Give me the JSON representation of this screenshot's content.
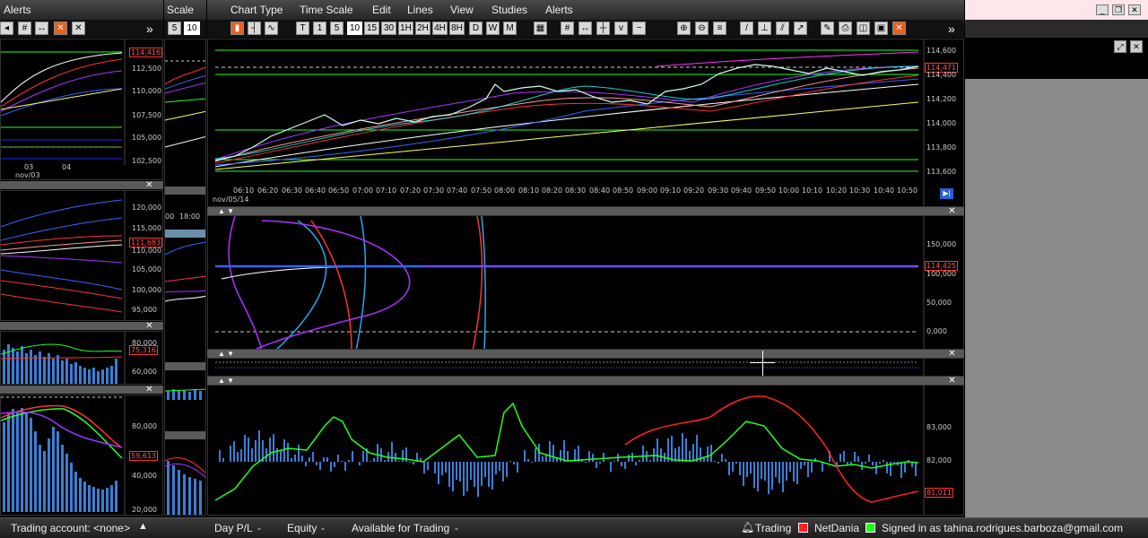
{
  "left_window": {
    "title": "Alerts"
  },
  "scale_window": {
    "title": "Scale",
    "btn_5": "5",
    "btn_10": "10",
    "time_00": "00",
    "time_1800": "18:00"
  },
  "menu": {
    "items": [
      "Chart Type",
      "Time Scale",
      "Edit",
      "Lines",
      "View",
      "Studies",
      "Alerts"
    ]
  },
  "toolbar": {
    "chevron": "»",
    "b1": "1",
    "b5": "5",
    "b10": "10",
    "b15": "15",
    "b30": "30",
    "b1h": "1H",
    "b2h": "2H",
    "b4h": "4H",
    "b8h": "8H",
    "bd": "D",
    "bw": "W",
    "bm": "M",
    "t_btn": "T"
  },
  "main_chart": {
    "price_labels": [
      "114,600",
      "114,400",
      "114,200",
      "114,000",
      "113,800",
      "113,600"
    ],
    "last_price": "114,471",
    "time_labels": [
      "06:10",
      "06:20",
      "06:30",
      "06:40",
      "06:50",
      "07:00",
      "07:10",
      "07:20",
      "07:30",
      "07:40",
      "07:50",
      "08:00",
      "08:10",
      "08:20",
      "08:30",
      "08:40",
      "08:50",
      "09:00",
      "09:10",
      "09:20",
      "09:30",
      "09:40",
      "09:50",
      "10:00",
      "10:10",
      "10:20",
      "10:30",
      "10:40",
      "10:50"
    ],
    "date_label": "nov/05/14"
  },
  "volume_panel": {
    "labels": [
      "150,000",
      "100,000",
      "50,000",
      "0,000"
    ],
    "badge": "114,425"
  },
  "oscillator_panel": {
    "labels": [
      "83,000",
      "82,000"
    ],
    "badge": "81,011"
  },
  "left_mini": {
    "p1_labels": [
      "114,000",
      "112,500",
      "110,000",
      "107,500",
      "105,000",
      "102,500"
    ],
    "p1_badge": "114,416",
    "p1_times": [
      "03",
      "04"
    ],
    "p1_date": "nov/03",
    "p2_labels": [
      "120,000",
      "115,000",
      "110,000",
      "105,000",
      "100,000",
      "95,000"
    ],
    "p2_badge": "111,683",
    "p3_labels": [
      "80,000",
      "60,000"
    ],
    "p3_badge": "75,316",
    "p4_labels": [
      "80,000",
      "60,000",
      "40,000",
      "20,000"
    ],
    "p4_badge": "59,613"
  },
  "status_bar": {
    "trading_account": "Trading account: <none>",
    "day_pl": "Day P/L",
    "equity": "Equity",
    "available": "Available for Trading",
    "dash": "-",
    "trading": "Trading",
    "netdania": "NetDania",
    "signed_in": "Signed in as tahina.rodrigues.barboza@gmail.com"
  },
  "colors": {
    "accent_red": "#ff3333",
    "accent_green": "#22dd22",
    "bar_blue": "#3a7fd5"
  }
}
